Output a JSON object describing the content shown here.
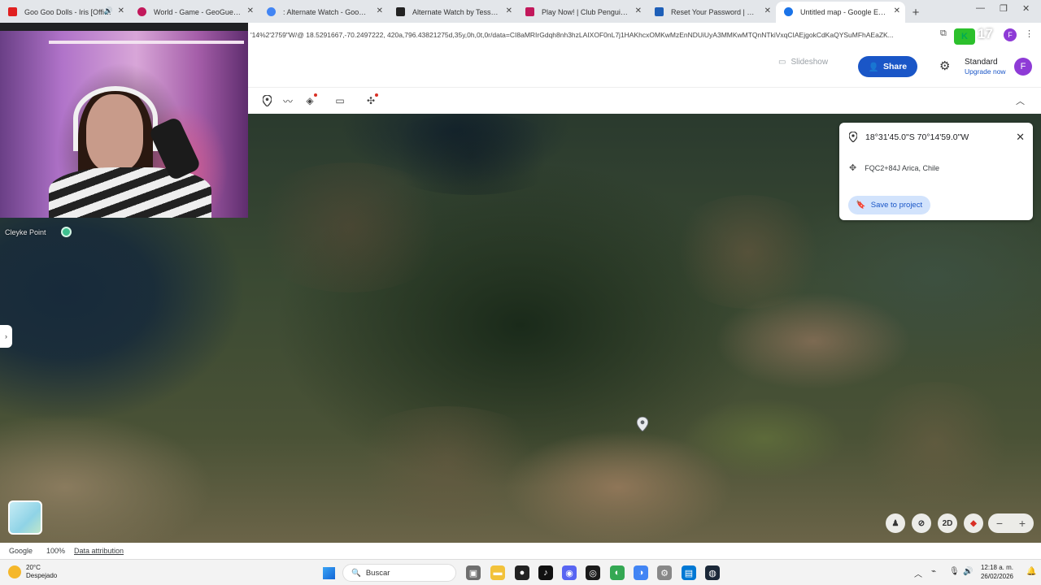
{
  "browser": {
    "tabs": [
      {
        "label": "Goo Goo Dolls - Iris [Officia",
        "favicon_color": "#e02020",
        "active": false
      },
      {
        "label": "World - Game - GeoGuessr",
        "favicon_color": "#c2185b",
        "active": false
      },
      {
        "label": ": Alternate Watch - Google Sea",
        "favicon_color": "#4285f4",
        "active": false
      },
      {
        "label": "Alternate Watch by Tesseron",
        "favicon_color": "#222222",
        "active": false
      },
      {
        "label": "Play Now! | Club Penguin Lega",
        "favicon_color": "#c2185b",
        "active": false
      },
      {
        "label": "Reset Your Password | Club Pe",
        "favicon_color": "#1e5fb8",
        "active": false
      },
      {
        "label": "Untitled map - Google Earth",
        "favicon_color": "#1a73e8",
        "active": true
      }
    ],
    "url": "'14%2'2759\"W/@ 18.5291667,-70.2497222, 420a,796.43821275d,35y,0h,0t,0r/data=CI8aMRIrGdqh8nh3hzLAIXOF0nL7j1HAKhcxOMKwMzEnNDUiUyA3MMKwMTQnNTkiVxqCIAEjgokCdKaQYSuMFhAEaZK...",
    "extension_count": "17",
    "profile_initial": "F"
  },
  "earth": {
    "slideshow_label": "Slideshow",
    "share_label": "Share",
    "plan_name": "Standard",
    "upgrade_label": "Upgrade now",
    "avatar_initial": "F",
    "info_card": {
      "coordinates": "18°31'45.0\"S 70°14'59.0\"W",
      "plus_code": "FQC2+84J Arica, Chile",
      "save_label": "Save to project"
    },
    "map_label": "Cleyke Point",
    "view_mode": "2D",
    "status": {
      "brand": "Google",
      "zoom": "100%",
      "attribution": "Data attribution"
    }
  },
  "taskbar": {
    "temperature": "20°C",
    "weather_desc": "Despejado",
    "search_placeholder": "Buscar",
    "time": "12:18 a. m.",
    "date": "26/02/2026"
  }
}
